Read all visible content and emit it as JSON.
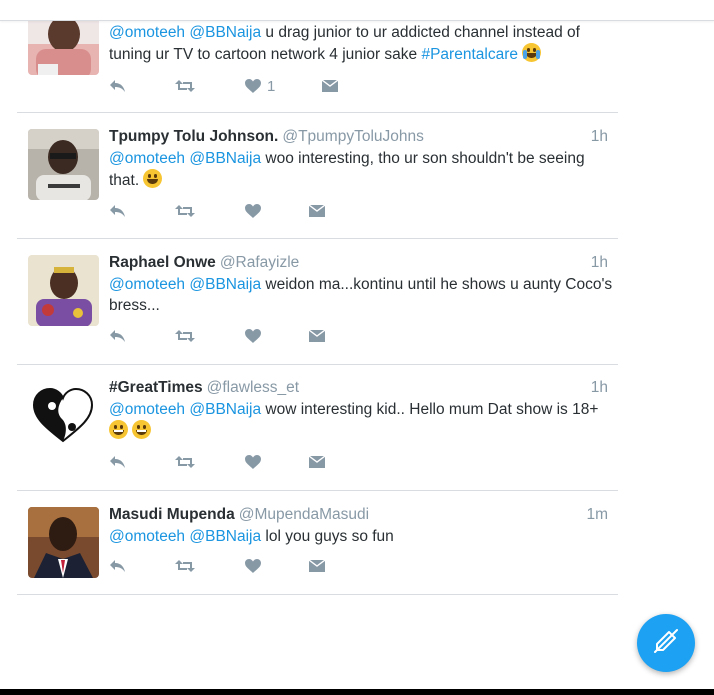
{
  "colors": {
    "accent": "#1b95e0",
    "muted": "#8899a6",
    "fab": "#1da1f2"
  },
  "tweets": [
    {
      "name": "",
      "handle": "",
      "time": "",
      "segments": [
        {
          "t": "mention",
          "v": "@omoteeh"
        },
        {
          "t": "text",
          "v": " "
        },
        {
          "t": "mention",
          "v": "@BBNaija"
        },
        {
          "t": "text",
          "v": " u drag junior to ur addicted channel instead of tuning ur TV to cartoon network 4 junior sake "
        },
        {
          "t": "hashtag",
          "v": "#Parentalcare"
        },
        {
          "t": "text",
          "v": " "
        },
        {
          "t": "emoji",
          "v": "crying-face"
        }
      ],
      "like_count": "1"
    },
    {
      "name": "Tpumpy Tolu Johnson.",
      "handle": "@TpumpyToluJohns",
      "time": "1h",
      "segments": [
        {
          "t": "mention",
          "v": "@omoteeh"
        },
        {
          "t": "text",
          "v": " "
        },
        {
          "t": "mention",
          "v": "@BBNaija"
        },
        {
          "t": "text",
          "v": " woo interesting, tho ur son shouldn't be seeing that. "
        },
        {
          "t": "emoji",
          "v": "grinning-face"
        }
      ],
      "like_count": ""
    },
    {
      "name": "Raphael Onwe",
      "handle": "@Rafayizle",
      "time": "1h",
      "segments": [
        {
          "t": "mention",
          "v": "@omoteeh"
        },
        {
          "t": "text",
          "v": " "
        },
        {
          "t": "mention",
          "v": "@BBNaija"
        },
        {
          "t": "text",
          "v": " weidon ma...kontinu until he shows u aunty Coco's bress..."
        }
      ],
      "like_count": ""
    },
    {
      "name": "#GreatTimes",
      "handle": "@flawless_et",
      "time": "1h",
      "segments": [
        {
          "t": "mention",
          "v": "@omoteeh"
        },
        {
          "t": "text",
          "v": " "
        },
        {
          "t": "mention",
          "v": "@BBNaija"
        },
        {
          "t": "text",
          "v": " wow interesting kid..  Hello mum Dat show is 18+ "
        },
        {
          "t": "emoji",
          "v": "grinning-face-with-teeth"
        },
        {
          "t": "text",
          "v": " "
        },
        {
          "t": "emoji",
          "v": "grinning-face-with-teeth"
        }
      ],
      "like_count": ""
    },
    {
      "name": "Masudi Mupenda",
      "handle": "@MupendaMasudi",
      "time": "1m",
      "segments": [
        {
          "t": "mention",
          "v": "@omoteeh"
        },
        {
          "t": "text",
          "v": " "
        },
        {
          "t": "mention",
          "v": "@BBNaija"
        },
        {
          "t": "text",
          "v": " lol you guys so fun"
        }
      ],
      "like_count": ""
    }
  ],
  "icons": {
    "reply": "reply-icon",
    "retweet": "retweet-icon",
    "like": "heart-icon",
    "dm": "direct-message-icon",
    "compose": "compose-tweet-icon"
  }
}
